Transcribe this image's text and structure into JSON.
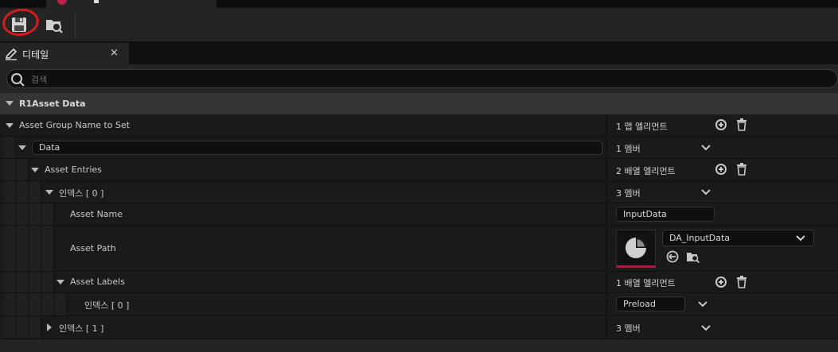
{
  "search": {
    "placeholder": "검색"
  },
  "panel_tab": {
    "label": "디테일",
    "close": "×"
  },
  "category": {
    "label": "R1Asset Data"
  },
  "rows": {
    "asset_group": {
      "name": "Asset Group Name to Set",
      "value": "1 맵 엘리먼트"
    },
    "data": {
      "key": "Data",
      "value": "1 멤버"
    },
    "asset_entries": {
      "name": "Asset Entries",
      "value": "2 배열 엘리먼트"
    },
    "index0": {
      "name": "인덱스 [ 0 ]",
      "value": "3 멤버"
    },
    "asset_name": {
      "name": "Asset Name",
      "value": "InputData"
    },
    "asset_path": {
      "name": "Asset Path",
      "value": "DA_InputData"
    },
    "asset_labels": {
      "name": "Asset Labels",
      "value": "1 배열 엘리먼트"
    },
    "label_index0": {
      "name": "인덱스 [ 0 ]",
      "value": "Preload"
    },
    "index1": {
      "name": "인덱스 [ 1 ]",
      "value": "3 멤버"
    }
  },
  "icons": [
    "save-icon",
    "browse-asset-icon",
    "details-icon",
    "search-icon",
    "add-icon",
    "trash-icon",
    "chevron-down-icon",
    "use-selected-icon"
  ],
  "colors": {
    "accent": "#b8224a",
    "highlight_circle": "#d41c1c",
    "background": "#242424",
    "row": "#1a1a1a"
  }
}
